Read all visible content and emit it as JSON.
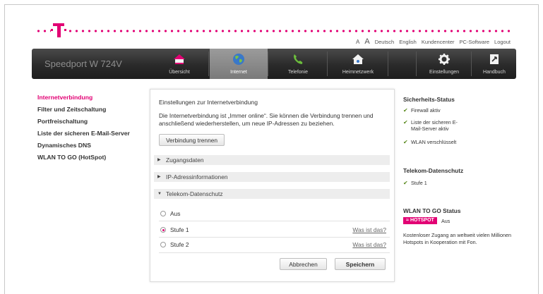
{
  "header": {
    "font_small": "A",
    "font_large": "A",
    "links": [
      "Deutsch",
      "English",
      "Kundencenter",
      "PC-Software",
      "Logout"
    ]
  },
  "brand_color": "#e20074",
  "nav": {
    "product": "Speedport W 724V",
    "items": [
      {
        "label": "Übersicht",
        "icon": "home-icon"
      },
      {
        "label": "Internet",
        "icon": "globe-icon",
        "active": true
      },
      {
        "label": "Telefonie",
        "icon": "phone-icon"
      },
      {
        "label": "Heimnetzwerk",
        "icon": "network-house-icon"
      },
      {
        "label": "Einstellungen",
        "icon": "gear-icon"
      },
      {
        "label": "Handbuch",
        "icon": "manual-icon"
      }
    ]
  },
  "sidebar": {
    "items": [
      {
        "label": "Internetverbindung",
        "active": true
      },
      {
        "label": "Filter und Zeitschaltung"
      },
      {
        "label": "Portfreischaltung"
      },
      {
        "label": "Liste der sicheren E-Mail-Server"
      },
      {
        "label": "Dynamisches DNS"
      },
      {
        "label": "WLAN TO GO (HotSpot)"
      }
    ]
  },
  "main": {
    "title": "Einstellungen zur Internetverbindung",
    "description": "Die Internetverbindung ist „Immer online“. Sie können die Verbindung trennen und anschließend wiederherstellen, um neue IP-Adressen zu beziehen.",
    "disconnect_button": "Verbindung trennen",
    "sections": [
      {
        "label": "Zugangsdaten",
        "expanded": false
      },
      {
        "label": "IP-Adressinformationen",
        "expanded": false
      },
      {
        "label": "Telekom-Datenschutz",
        "expanded": true
      }
    ],
    "privacy_options": [
      {
        "label": "Aus",
        "selected": false,
        "help": ""
      },
      {
        "label": "Stufe 1",
        "selected": true,
        "help": "Was ist das?"
      },
      {
        "label": "Stufe 2",
        "selected": false,
        "help": "Was ist das?"
      }
    ],
    "cancel_button": "Abbrechen",
    "save_button": "Speichern"
  },
  "status": {
    "security_title": "Sicherheits-Status",
    "security_items": [
      "Firewall aktiv",
      "Liste der sicheren E-Mail-Server aktiv",
      "WLAN verschlüsselt"
    ],
    "privacy_title": "Telekom-Datenschutz",
    "privacy_items": [
      "Stufe 1"
    ],
    "wlan_title": "WLAN TO GO Status",
    "hotspot_badge": "HOTSPOT",
    "hotspot_value": "Aus",
    "hotspot_description": "Kostenloser Zugang an weltweit vielen Millionen Hotspots in Kooperation mit Fon."
  }
}
